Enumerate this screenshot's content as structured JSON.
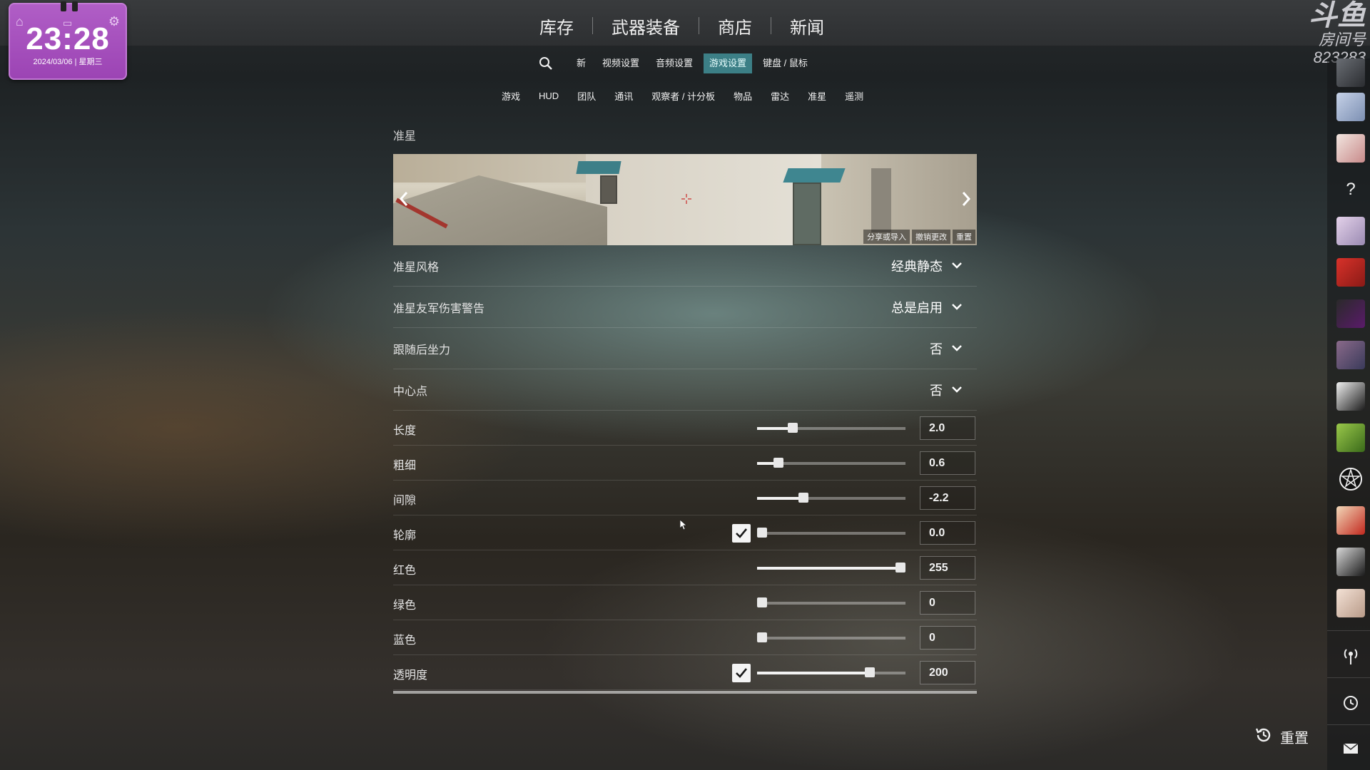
{
  "clock": {
    "time": "23:28",
    "date": "2024/03/06 | 星期三"
  },
  "main_nav": [
    "库存",
    "武器装备",
    "商店",
    "新闻"
  ],
  "room": {
    "logo": "斗鱼",
    "label": "房间号",
    "number": "823283"
  },
  "sub_nav": {
    "tabs": [
      "新",
      "视频设置",
      "音频设置",
      "游戏设置",
      "键盘 / 鼠标"
    ],
    "active": "游戏设置"
  },
  "category_nav": [
    "游戏",
    "HUD",
    "团队",
    "通讯",
    "观察者 / 计分板",
    "物品",
    "雷达",
    "准星",
    "遥测"
  ],
  "section": {
    "title": "准星",
    "preview_actions": [
      "分享或导入",
      "撤销更改",
      "重置"
    ]
  },
  "dropdowns": [
    {
      "label": "准星风格",
      "value": "经典静态"
    },
    {
      "label": "准星友军伤害警告",
      "value": "总是启用"
    },
    {
      "label": "跟随后坐力",
      "value": "否"
    },
    {
      "label": "中心点",
      "value": "否"
    }
  ],
  "sliders": [
    {
      "label": "长度",
      "value": "2.0",
      "fraction": 0.22,
      "checkbox": false
    },
    {
      "label": "粗细",
      "value": "0.6",
      "fraction": 0.12,
      "checkbox": false
    },
    {
      "label": "间隙",
      "value": "-2.2",
      "fraction": 0.3,
      "checkbox": false
    },
    {
      "label": "轮廓",
      "value": "0.0",
      "fraction": 0.0,
      "checkbox": true,
      "checked": true
    },
    {
      "label": "红色",
      "value": "255",
      "fraction": 1.0,
      "checkbox": false
    },
    {
      "label": "绿色",
      "value": "0",
      "fraction": 0.0,
      "checkbox": false
    },
    {
      "label": "蓝色",
      "value": "0",
      "fraction": 0.0,
      "checkbox": false
    },
    {
      "label": "透明度",
      "value": "200",
      "fraction": 0.78,
      "checkbox": true,
      "checked": true
    }
  ],
  "footer": {
    "reset_label": "重置"
  },
  "sidebar": {
    "avatars": [
      "friend-avatar-1",
      "friend-avatar-2",
      "help-icon",
      "friend-avatar-3",
      "friend-avatar-4",
      "friend-avatar-5",
      "friend-avatar-6",
      "friend-avatar-7",
      "friend-avatar-8",
      "friend-avatar-9",
      "friend-avatar-10",
      "friend-avatar-11",
      "friend-avatar-12"
    ],
    "bottom_icons": [
      "broadcast-icon",
      "history-icon",
      "mail-icon"
    ]
  },
  "colors": {
    "accent": "#3c7f86",
    "clock_bg": "#a450bc",
    "crosshair": "#cc2a2a"
  }
}
